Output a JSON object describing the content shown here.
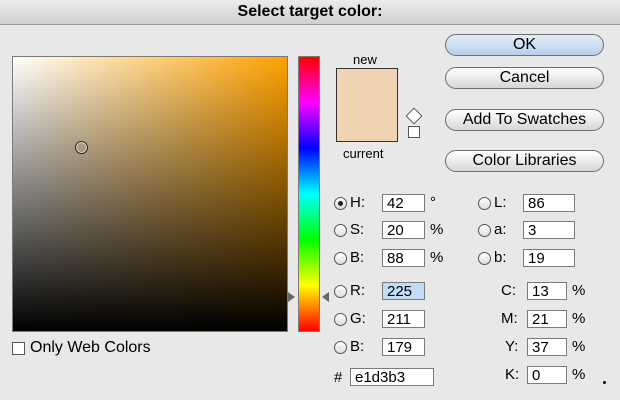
{
  "dialog": {
    "title": "Select target color:"
  },
  "preview": {
    "new_label": "new",
    "current_label": "current",
    "new_color": "#f0d3b3",
    "current_color": "#f0d3b3"
  },
  "buttons": {
    "ok": "OK",
    "cancel": "Cancel",
    "add_swatches": "Add To Swatches",
    "color_libraries": "Color Libraries"
  },
  "hsb": {
    "h": {
      "label": "H:",
      "value": "42",
      "unit": "°"
    },
    "s": {
      "label": "S:",
      "value": "20",
      "unit": "%"
    },
    "b": {
      "label": "B:",
      "value": "88",
      "unit": "%"
    }
  },
  "rgb": {
    "r": {
      "label": "R:",
      "value": "225"
    },
    "g": {
      "label": "G:",
      "value": "211"
    },
    "b": {
      "label": "B:",
      "value": "179"
    }
  },
  "lab": {
    "l": {
      "label": "L:",
      "value": "86"
    },
    "a": {
      "label": "a:",
      "value": "3"
    },
    "b": {
      "label": "b:",
      "value": "19"
    }
  },
  "cmyk": {
    "c": {
      "label": "C:",
      "value": "13",
      "unit": "%"
    },
    "m": {
      "label": "M:",
      "value": "21",
      "unit": "%"
    },
    "y": {
      "label": "Y:",
      "value": "37",
      "unit": "%"
    },
    "k": {
      "label": "K:",
      "value": "0",
      "unit": "%"
    }
  },
  "hex": {
    "label": "#",
    "value": "e1d3b3"
  },
  "web_colors": {
    "label": "Only Web Colors"
  },
  "selected_mode": "H",
  "icons": {
    "gamut": "cube-icon",
    "web_safe": "square-icon"
  }
}
